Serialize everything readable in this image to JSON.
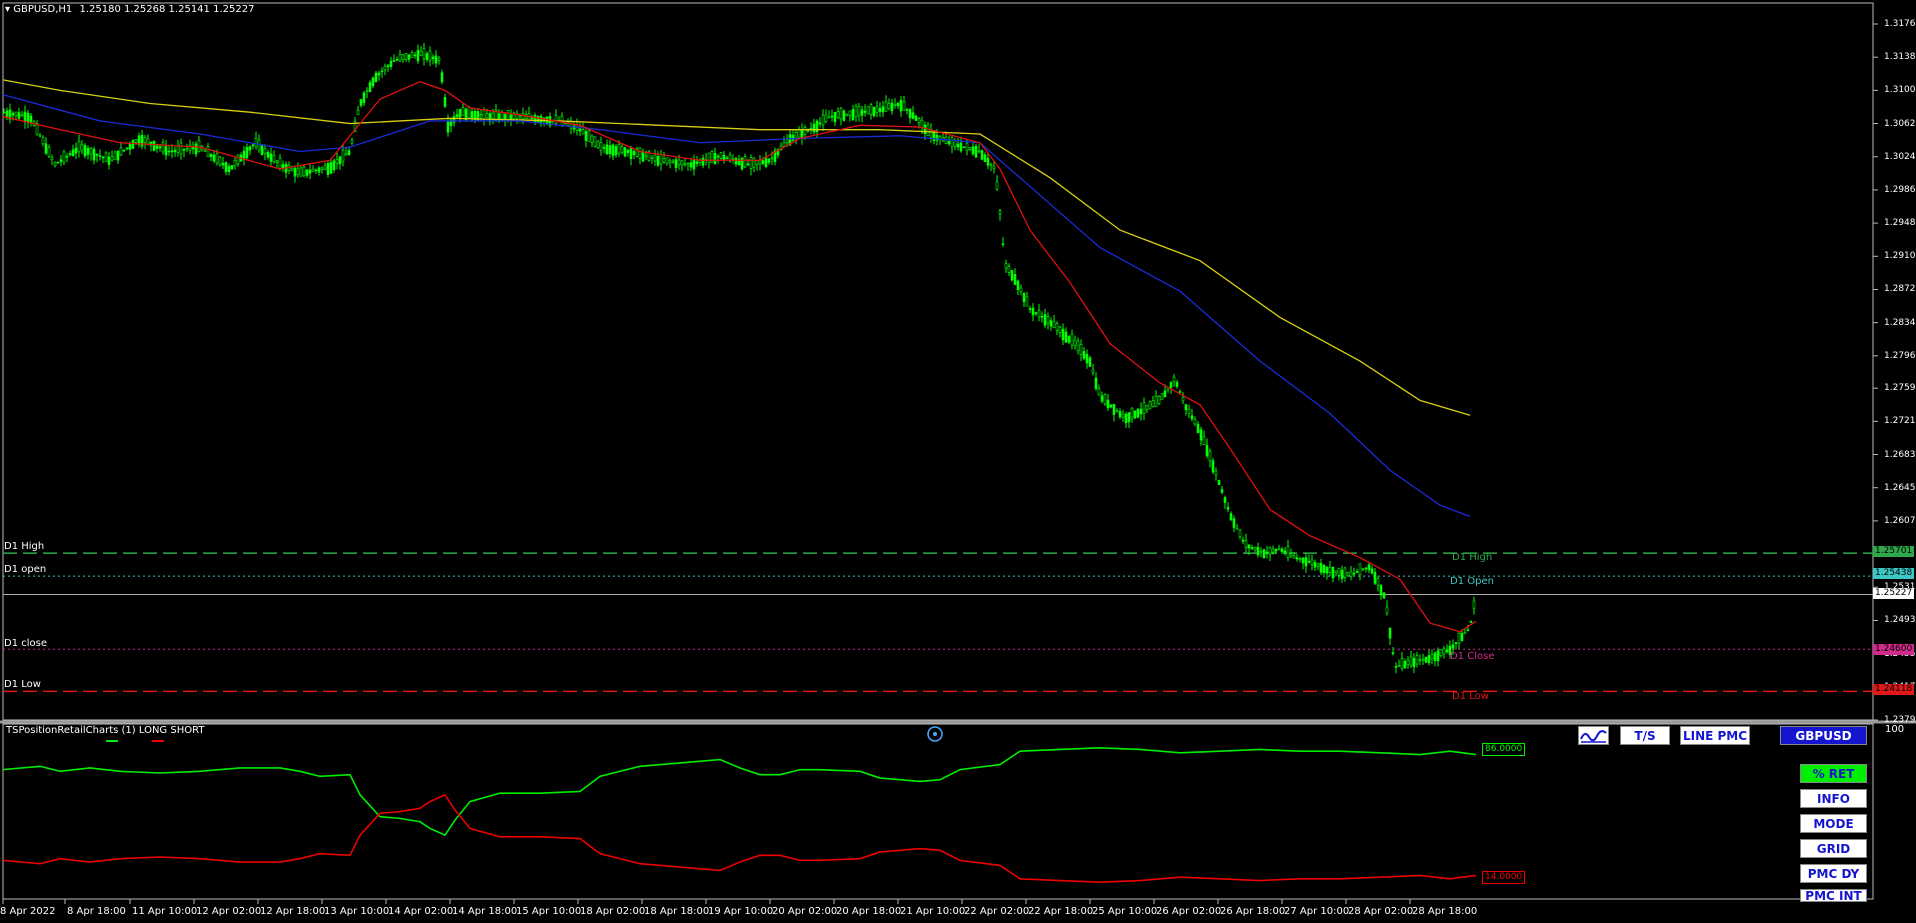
{
  "header": {
    "symbol_label": "GBPUSD,H1",
    "ohlc": "1.25180 1.25268 1.25141 1.25227"
  },
  "price_axis": [
    "1.31760",
    "1.31380",
    "1.31000",
    "1.30620",
    "1.30240",
    "1.29860",
    "1.29480",
    "1.29100",
    "1.28720",
    "1.28340",
    "1.27960",
    "1.27590",
    "1.27210",
    "1.26830",
    "1.26450",
    "1.26070",
    "1.25310",
    "1.24930",
    "1.24550",
    "1.24170",
    "1.23790"
  ],
  "levels": {
    "high": {
      "left_label": "D1 High",
      "right_label": "D1 High",
      "price": "1.25701",
      "color": "#2ea84a"
    },
    "open": {
      "left_label": "D1 open",
      "right_label": "D1 Open",
      "price": "1.25438",
      "color": "#3cc6c6"
    },
    "close": {
      "left_label": "D1 close",
      "right_label": "D1 Close",
      "price": "1.24600",
      "color": "#d02a8a"
    },
    "low": {
      "left_label": "D1 Low",
      "right_label": "D1 Low",
      "price": "1.24118",
      "color": "#e01818"
    },
    "current_price": "1.25227"
  },
  "indicator": {
    "title": "TSPositionRetailCharts (1) LONG SHORT",
    "scale_top": "100",
    "long_value": "86.0000",
    "short_value": "14.0000",
    "long_color": "#00ee00",
    "short_color": "#ee0000"
  },
  "buttons": {
    "wave_icon": "wave-icon",
    "ts": "T/S",
    "line_pmc": "LINE PMC",
    "symbol": "GBPUSD",
    "ret": "% RET",
    "info": "INFO",
    "mode": "MODE",
    "grid": "GRID",
    "pmc_dy": "PMC DY",
    "pmc_int": "PMC INT"
  },
  "time_axis": [
    "8 Apr 2022",
    "8 Apr 18:00",
    "11 Apr 10:00",
    "12 Apr 02:00",
    "12 Apr 18:00",
    "13 Apr 10:00",
    "14 Apr 02:00",
    "14 Apr 18:00",
    "15 Apr 10:00",
    "18 Apr 02:00",
    "18 Apr 18:00",
    "19 Apr 10:00",
    "20 Apr 02:00",
    "20 Apr 18:00",
    "21 Apr 10:00",
    "22 Apr 02:00",
    "22 Apr 18:00",
    "25 Apr 10:00",
    "26 Apr 02:00",
    "26 Apr 18:00",
    "27 Apr 10:00",
    "28 Apr 02:00",
    "28 Apr 18:00"
  ],
  "colors": {
    "candle": "#00ff00",
    "ma_fast": "#e01010",
    "ma_mid": "#1a2ad8",
    "ma_slow": "#d8d010"
  }
}
